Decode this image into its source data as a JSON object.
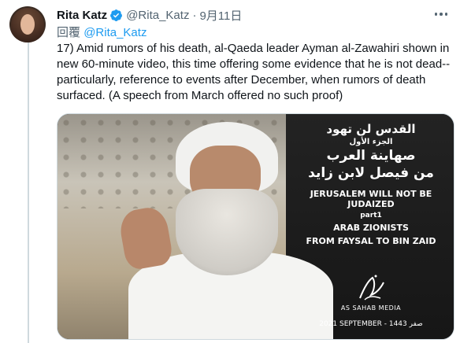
{
  "tweet": {
    "author_name": "Rita Katz",
    "handle": "@Rita_Katz",
    "separator": "·",
    "date": "9月11日",
    "reply_prefix": "回覆",
    "reply_to": "@Rita_Katz",
    "text": "17) Amid rumors of his death, al-Qaeda leader Ayman al-Zawahiri shown in new 60-minute video, this time offering some evidence that he is not dead--particularly, reference to events after December, when rumors of death surfaced. (A speech from March offered no such proof)"
  },
  "media": {
    "arabic_line1": "القدس لن تهود",
    "arabic_line2": "الجزء الأول",
    "arabic_line3": "صهاينة العرب",
    "arabic_line4": "من فيصل لابن زايد",
    "english_line1": "JERUSALEM WILL NOT BE JUDAIZED",
    "english_line2": "part1",
    "english_line3": "ARAB ZIONISTS",
    "english_line4": "FROM FAYSAL TO BIN ZAID",
    "publisher": "AS SAHAB MEDIA",
    "date_line": "2021 SEPTEMBER - 1443 صفر"
  },
  "icons": {
    "verified": "verified-badge-icon",
    "more": "more-options-icon"
  },
  "colors": {
    "accent": "#1d9bf0",
    "secondary_text": "#536471",
    "primary_text": "#0f1419",
    "thread_line": "#cfd9de"
  }
}
